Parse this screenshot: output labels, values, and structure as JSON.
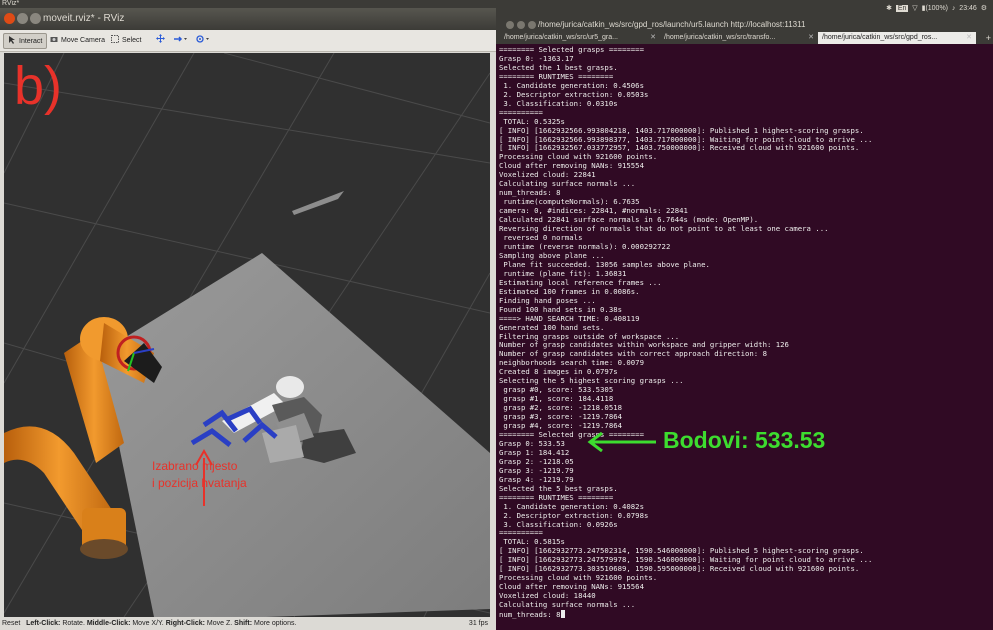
{
  "desktop": {
    "top_title": "RViz*"
  },
  "rviz": {
    "window_title": "moveit.rviz* - RViz",
    "toolbar": {
      "interact": "Interact",
      "move_camera": "Move Camera",
      "select": "Select"
    },
    "overlay_label": "b)",
    "annotation": "Izabrano mjesto\ni pozicija hvatanja",
    "status": {
      "reset": "Reset",
      "hint_left_key": "Left-Click:",
      "hint_left": " Rotate. ",
      "hint_middle_key": "Middle-Click:",
      "hint_middle": " Move X/Y. ",
      "hint_right_key": "Right-Click:",
      "hint_right": " Move Z. ",
      "hint_shift_key": "Shift:",
      "hint_shift": " More options."
    },
    "fps": "31 fps"
  },
  "system_tray": {
    "battery": "(100%)",
    "time": "23:46",
    "keyboard": "En"
  },
  "terminal": {
    "window_title": "/home/jurica/catkin_ws/src/gpd_ros/launch/ur5.launch http://localhost:11311",
    "tabs": [
      {
        "label": "/home/jurica/catkin_ws/src/ur5_gra...",
        "active": false
      },
      {
        "label": "/home/jurica/catkin_ws/src/transfo...",
        "active": false
      },
      {
        "label": "/home/jurica/catkin_ws/src/gpd_ros...",
        "active": true
      }
    ],
    "lines": [
      "======== Selected grasps ========",
      "Grasp 0: -1363.17",
      "Selected the 1 best grasps.",
      "======== RUNTIMES ========",
      " 1. Candidate generation: 0.4506s",
      " 2. Descriptor extraction: 0.0503s",
      " 3. Classification: 0.0310s",
      "==========",
      " TOTAL: 0.5325s",
      "[ INFO] [1662932566.993804218, 1403.717000000]: Published 1 highest-scoring grasps.",
      "[ INFO] [1662932566.993898377, 1403.717000000]: Waiting for point cloud to arrive ...",
      "[ INFO] [1662932567.033772957, 1403.750000000]: Received cloud with 921600 points.",
      "Processing cloud with 921600 points.",
      "Cloud after removing NANs: 915554",
      "Voxelized cloud: 22841",
      "Calculating surface normals ...",
      "num_threads: 8",
      " runtime(computeNormals): 6.7635",
      "camera: 0, #indices: 22841, #normals: 22841",
      "Calculated 22841 surface normals in 6.7644s (mode: OpenMP).",
      "Reversing direction of normals that do not point to at least one camera ...",
      " reversed 0 normals",
      " runtime (reverse normals): 0.000292722",
      "Sampling above plane ...",
      " Plane fit succeeded. 13056 samples above plane.",
      " runtime (plane fit): 1.36831",
      "Estimating local reference frames ...",
      "Estimated 100 frames in 0.0086s.",
      "Finding hand poses ...",
      "Found 100 hand sets in 0.38s",
      "====> HAND SEARCH TIME: 0.408119",
      "Generated 100 hand sets.",
      "Filtering grasps outside of workspace ...",
      "Number of grasp candidates within workspace and gripper width: 126",
      "Number of grasp candidates with correct approach direction: 8",
      "neighborhoods search time: 0.0079",
      "Created 8 images in 0.0797s",
      "Selecting the 5 highest scoring grasps ...",
      " grasp #0, score: 533.5305",
      " grasp #1, score: 184.4118",
      " grasp #2, score: -1218.0518",
      " grasp #3, score: -1219.7864",
      " grasp #4, score: -1219.7864",
      "======== Selected grasps ========",
      "Grasp 0: 533.53",
      "Grasp 1: 184.412",
      "Grasp 2: -1218.05",
      "Grasp 3: -1219.79",
      "Grasp 4: -1219.79",
      "Selected the 5 best grasps.",
      "======== RUNTIMES ========",
      " 1. Candidate generation: 0.4082s",
      " 2. Descriptor extraction: 0.0798s",
      " 3. Classification: 0.0926s",
      "==========",
      " TOTAL: 0.5815s",
      "[ INFO] [1662932773.247502314, 1590.546000000]: Published 5 highest-scoring grasps.",
      "[ INFO] [1662932773.247579978, 1590.546000000]: Waiting for point cloud to arrive ...",
      "[ INFO] [1662932773.303510689, 1590.595000000]: Received cloud with 921600 points.",
      "Processing cloud with 921600 points.",
      "Cloud after removing NANs: 915564",
      "Voxelized cloud: 18440",
      "Calculating surface normals ...",
      "num_threads: 8"
    ],
    "callout": "Bodovi: 533.53"
  },
  "colors": {
    "annotation_red": "#e8322a",
    "annotation_green": "#3ddc2f",
    "terminal_bg": "#300a24",
    "robot_orange": "#e8861e",
    "gripper_blue": "#2a3fc4"
  }
}
